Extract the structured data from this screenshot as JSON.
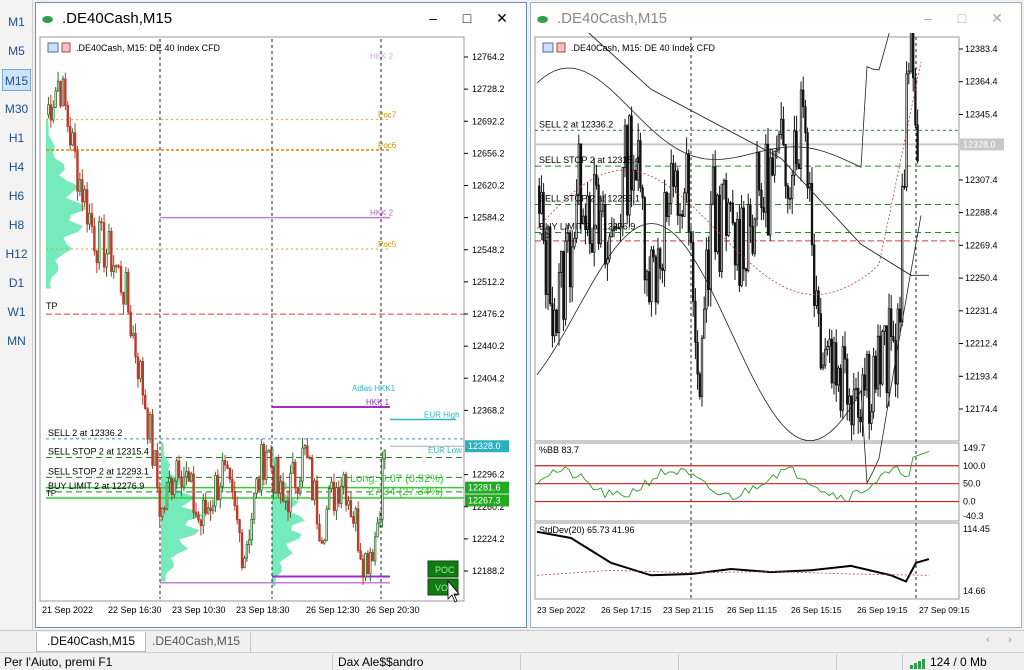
{
  "timeframes": [
    "M1",
    "M5",
    "M15",
    "M30",
    "H1",
    "H4",
    "H6",
    "H8",
    "H12",
    "D1",
    "W1",
    "MN"
  ],
  "active_timeframe": "M15",
  "left_window": {
    "title": ".DE40Cash,M15",
    "header": ".DE40Cash, M15:  DE 40 Index CFD",
    "price_ticks": [
      "12764.2",
      "12728.2",
      "12692.2",
      "12656.2",
      "12620.2",
      "12584.2",
      "12548.2",
      "12512.2",
      "12476.2",
      "12440.2",
      "12404.2",
      "12368.2",
      "12296.2",
      "12260.2",
      "12224.2",
      "12188.2"
    ],
    "current_price": "12328.0",
    "level_labels": [
      "12281.6",
      "12267.3"
    ],
    "time_ticks": [
      "21 Sep 2022",
      "22 Sep 16:30",
      "23 Sep 10:30",
      "23 Sep 18:30",
      "26 Sep 12:30",
      "26 Sep 20:30"
    ],
    "orders": [
      "SELL 2 at 12336.2",
      "SELL STOP 2 at 12315.4",
      "SELL STOP 2 at 12293.1",
      "BUY LIMIT 2 at 12276.9"
    ],
    "tp_label": "TP",
    "annotations": {
      "hkk": "HKK 2",
      "poc7": "Poc7",
      "poc6": "Poc6",
      "poc5": "Poc5",
      "adlas": "Adlas HKK1",
      "hkk1": "HKK 1",
      "eur_high": "EUR High",
      "eur_low": "EUR Low",
      "long": "Long: 9.07 (0.92%)",
      "long2": "27.34 (27.34%)",
      "poc_btn": "POC",
      "vol_btn": "VOL"
    },
    "colors": {
      "bull": "#2a6e2a",
      "bear": "#c0392b",
      "profile": "#5de8b0",
      "purple": "#9b30c8",
      "cyan": "#2ab7c8",
      "price_tag": "#2bb0c0",
      "level_tag": "#22aa22"
    }
  },
  "right_window": {
    "title": ".DE40Cash,M15",
    "header": ".DE40Cash, M15:  DE 40 Index CFD",
    "price_ticks": [
      "12383.4",
      "12364.4",
      "12345.4",
      "12307.4",
      "12288.4",
      "12269.4",
      "12250.4",
      "12231.4",
      "12212.4",
      "12193.4",
      "12174.4"
    ],
    "current_price": "12328.0",
    "orders": [
      "SELL 2 at 12336.2",
      "SELL STOP 2 at 12315.4",
      "SELL STOP 2 at 12293.1",
      "BUY LIMIT 2 at 12276.9"
    ],
    "tp_label": "TP",
    "bb_label": "%BB 83.7",
    "bb_ticks": [
      "149.7",
      "100.0",
      "50.0",
      "0.0",
      "-40.3"
    ],
    "sd_label": "StdDev(20) 65.73 41.96",
    "sd_ticks": [
      "114.45",
      "14.66"
    ],
    "time_ticks": [
      "23 Sep 2022",
      "26 Sep 17:15",
      "23 Sep 21:15",
      "26 Sep 11:15",
      "26 Sep 15:15",
      "26 Sep 19:15",
      "27 Sep 09:15"
    ]
  },
  "tabs": [
    ".DE40Cash,M15",
    ".DE40Cash,M15"
  ],
  "status": {
    "help": "Per l'Aiuto, premi F1",
    "profile": "Dax Ale$$andro",
    "traffic": "124 / 0 Mb"
  }
}
